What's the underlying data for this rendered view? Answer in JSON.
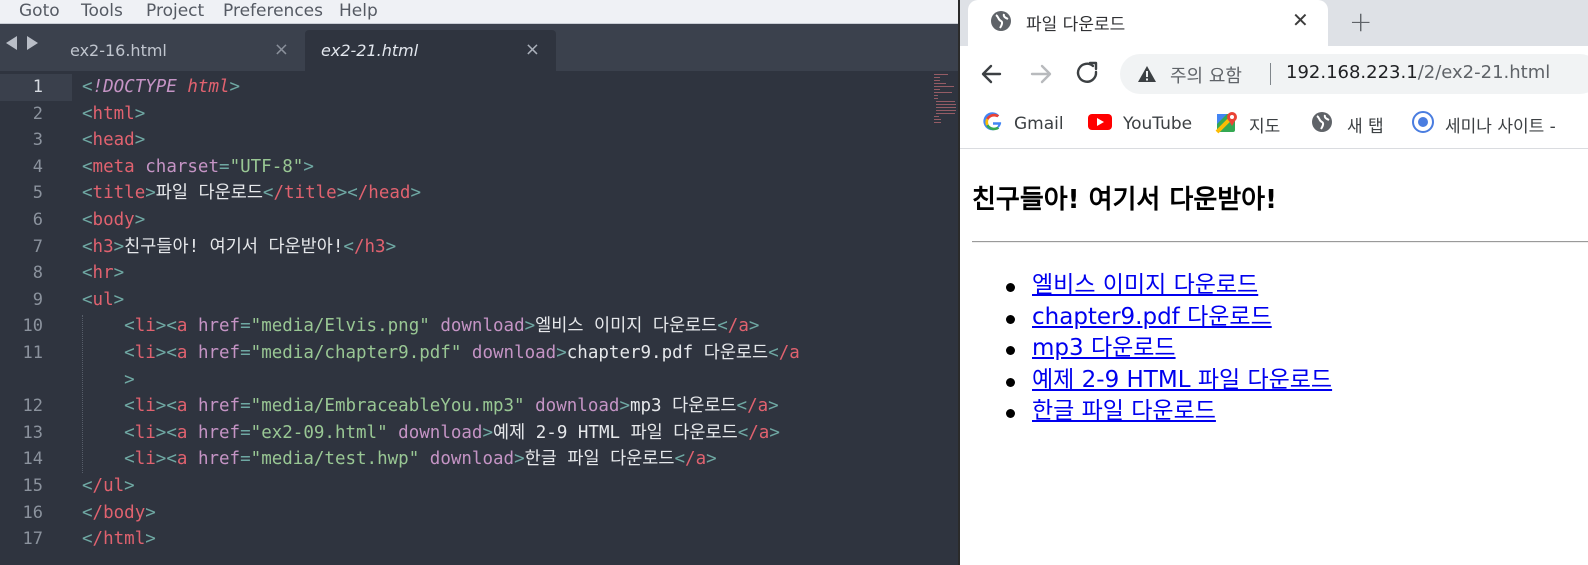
{
  "editor": {
    "menu": [
      "Goto",
      "Tools",
      "Project",
      "Preferences",
      "Help"
    ],
    "tabs": [
      {
        "label": "ex2-16.html",
        "close": "×",
        "active": false
      },
      {
        "label": "ex2-21.html",
        "close": "×",
        "active": true
      }
    ],
    "line_numbers": [
      "1",
      "2",
      "3",
      "4",
      "5",
      "6",
      "7",
      "8",
      "9",
      "10",
      "11",
      "",
      "12",
      "13",
      "14",
      "15",
      "16",
      "17"
    ],
    "code": {
      "l1_kw": "!DOCTYPE",
      "l1_kt": "html",
      "l2_tag": "html",
      "l3_tag": "head",
      "l4_tag": "meta",
      "l4_attr": "charset",
      "l4_val": "\"UTF-8\"",
      "l5_tag": "title",
      "l5_text": "파일 다운로드",
      "l5_close1": "/title",
      "l5_close2": "/head",
      "l6_tag": "body",
      "l7_tag": "h3",
      "l7_text": "친구들아! 여기서 다운받아!",
      "l7_close": "/h3",
      "l8_tag": "hr",
      "l9_tag": "ul",
      "li_tag": "li",
      "a_tag": "a",
      "href_attr": "href",
      "download_attr": "download",
      "a_close": "/a",
      "l10_href": "\"media/Elvis.png\"",
      "l10_text": "엘비스 이미지 다운로드",
      "l11_href": "\"media/chapter9.pdf\"",
      "l11_text": "chapter9.pdf 다운로드",
      "l11_close": "/a",
      "l12_href": "\"media/EmbraceableYou.mp3\"",
      "l12_text": "mp3 다운로드",
      "l13_href": "\"ex2-09.html\"",
      "l13_text": "예제 2-9 HTML 파일 다운로드",
      "l14_href": "\"media/test.hwp\"",
      "l14_text": "한글 파일 다운로드",
      "l15_tag": "/ul",
      "l16_tag": "/body",
      "l17_tag": "/html"
    }
  },
  "browser": {
    "tab_title": "파일 다운로드",
    "tab_close": "✕",
    "new_tab": "+",
    "security_label": "주의 요함",
    "url_host": "192.168.223.1",
    "url_path": "/2/ex2-21.html",
    "bookmarks": [
      "Gmail",
      "YouTube",
      "지도",
      "새 탭",
      "세미나 사이트 -"
    ],
    "icons": {
      "back": "back-arrow-icon",
      "forward": "forward-arrow-icon",
      "reload": "reload-icon",
      "warning": "warning-icon",
      "globe": "globe-icon"
    },
    "page": {
      "heading": "친구들아! 여기서 다운받아!",
      "links": [
        "엘비스 이미지 다운로드",
        "chapter9.pdf 다운로드",
        "mp3 다운로드",
        "예제 2-9 HTML 파일 다운로드",
        "한글 파일 다운로드"
      ]
    }
  },
  "colors": {
    "editor_bg": "#2f343f",
    "tag": "#e0626f",
    "attr": "#c594c5",
    "string": "#99c794",
    "link": "#0000ee"
  }
}
